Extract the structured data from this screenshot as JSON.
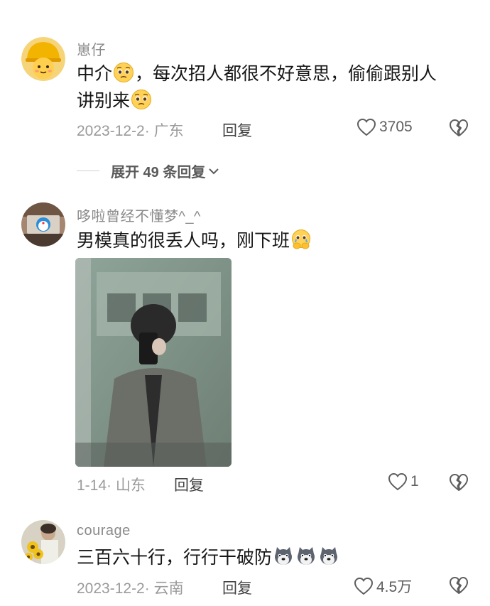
{
  "comments": [
    {
      "username": "崽仔",
      "text_1": "中介",
      "text_2": "，每次招人都很不好意思，偷偷跟别人",
      "text_3": "讲别来",
      "date_location": "2023-12-2· 广东",
      "reply_label": "回复",
      "likes": "3705",
      "avatar_icon": "helmet-face-avatar",
      "emoji_icon": "pleading-face-emoji"
    },
    {
      "username": "哆啦曾经不懂梦^_^",
      "text": "男模真的很丢人吗，刚下班",
      "date_location": "1-14· 山东",
      "reply_label": "回复",
      "likes": "1",
      "avatar_icon": "doraemon-avatar",
      "emoji_icon": "crying-hands-emoji",
      "photo_icon": "mirror-selfie-photo"
    },
    {
      "username": "courage",
      "text": "三百六十行，行行干破防",
      "date_location": "2023-12-2· 云南",
      "reply_label": "回复",
      "likes": "4.5万",
      "avatar_icon": "sunflower-avatar",
      "emoji_icon": "husky-dog-emoji"
    }
  ],
  "expand_replies": {
    "label": "展开 49 条回复"
  },
  "colors": {
    "text": "#161616",
    "meta": "#9a9a9a",
    "username": "#8a8a8a"
  }
}
